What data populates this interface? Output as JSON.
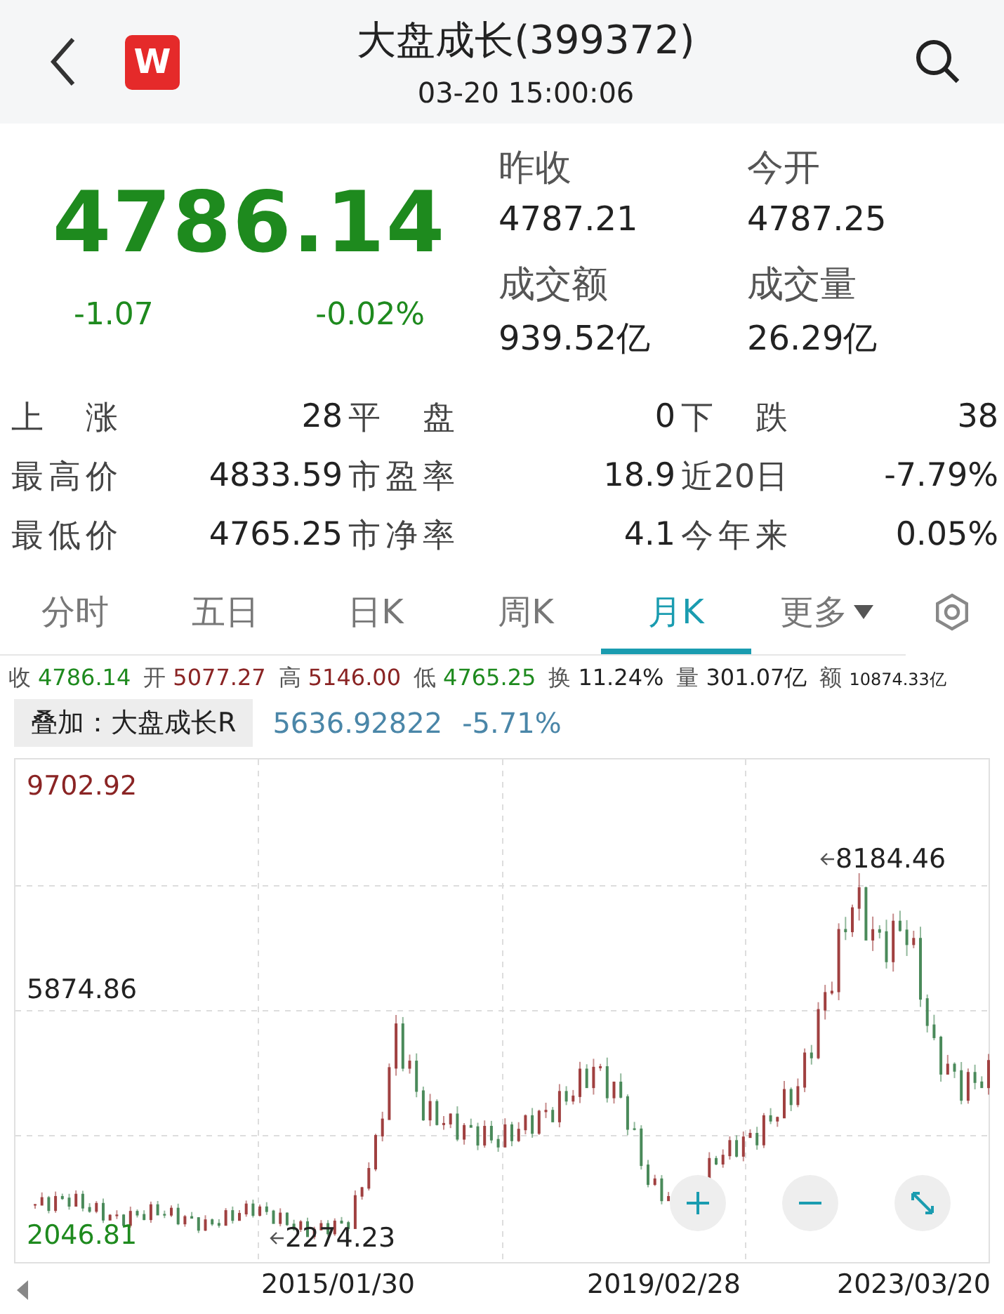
{
  "header": {
    "logo_letter": "W",
    "title": "大盘成长(399372)",
    "time": "03-20 15:00:06"
  },
  "quote": {
    "price": "4786.14",
    "change": "-1.07",
    "change_pct": "-0.02%",
    "color": "#1e8a1e",
    "fields": [
      {
        "label": "昨收",
        "value": "4787.21"
      },
      {
        "label": "今开",
        "value": "4787.25"
      },
      {
        "label": "成交额",
        "value": "939.52亿"
      },
      {
        "label": "成交量",
        "value": "26.29亿"
      }
    ]
  },
  "stats": [
    [
      {
        "label": "上涨",
        "value": "28"
      },
      {
        "label": "平盘",
        "value": "0"
      },
      {
        "label": "下跌",
        "value": "38"
      }
    ],
    [
      {
        "label": "最高价",
        "value": "4833.59"
      },
      {
        "label": "市盈率",
        "value": "18.9"
      },
      {
        "label": "近20日",
        "value": "-7.79%"
      }
    ],
    [
      {
        "label": "最低价",
        "value": "4765.25"
      },
      {
        "label": "市净率",
        "value": "4.1"
      },
      {
        "label": "今年来",
        "value": "0.05%"
      }
    ]
  ],
  "tabs": [
    {
      "label": "分时",
      "selected": false
    },
    {
      "label": "五日",
      "selected": false
    },
    {
      "label": "日K",
      "selected": false
    },
    {
      "label": "周K",
      "selected": false
    },
    {
      "label": "月K",
      "selected": true
    },
    {
      "label": "更多",
      "selected": false,
      "kind": "dropdown"
    }
  ],
  "ohlc": [
    {
      "label": "收",
      "value": "4786.14",
      "color": "#1e8a1e"
    },
    {
      "label": "开",
      "value": "5077.27",
      "color": "#8a2424"
    },
    {
      "label": "高",
      "value": "5146.00",
      "color": "#8a2424"
    },
    {
      "label": "低",
      "value": "4765.25",
      "color": "#1e8a1e"
    },
    {
      "label": "换",
      "value": "11.24%",
      "color": "#222222"
    },
    {
      "label": "量",
      "value": "301.07亿",
      "color": "#222222"
    },
    {
      "label": "额",
      "value": "10874.33亿",
      "color": "#222222",
      "kind": "compact"
    }
  ],
  "overlay": {
    "label": "叠加：大盘成长R",
    "value": "5636.92822",
    "change": "-5.71%"
  },
  "chart": {
    "y_labels": [
      {
        "text": "9702.92",
        "color": "#8a2424"
      },
      {
        "text": "5874.86",
        "color": "#222222"
      },
      {
        "text": "2046.81",
        "color": "#1e8a1e"
      }
    ],
    "markers": [
      "8184.46",
      "2274.23"
    ],
    "x_labels": [
      "2015/01/30",
      "2019/02/28",
      "2023/03/20"
    ]
  }
}
